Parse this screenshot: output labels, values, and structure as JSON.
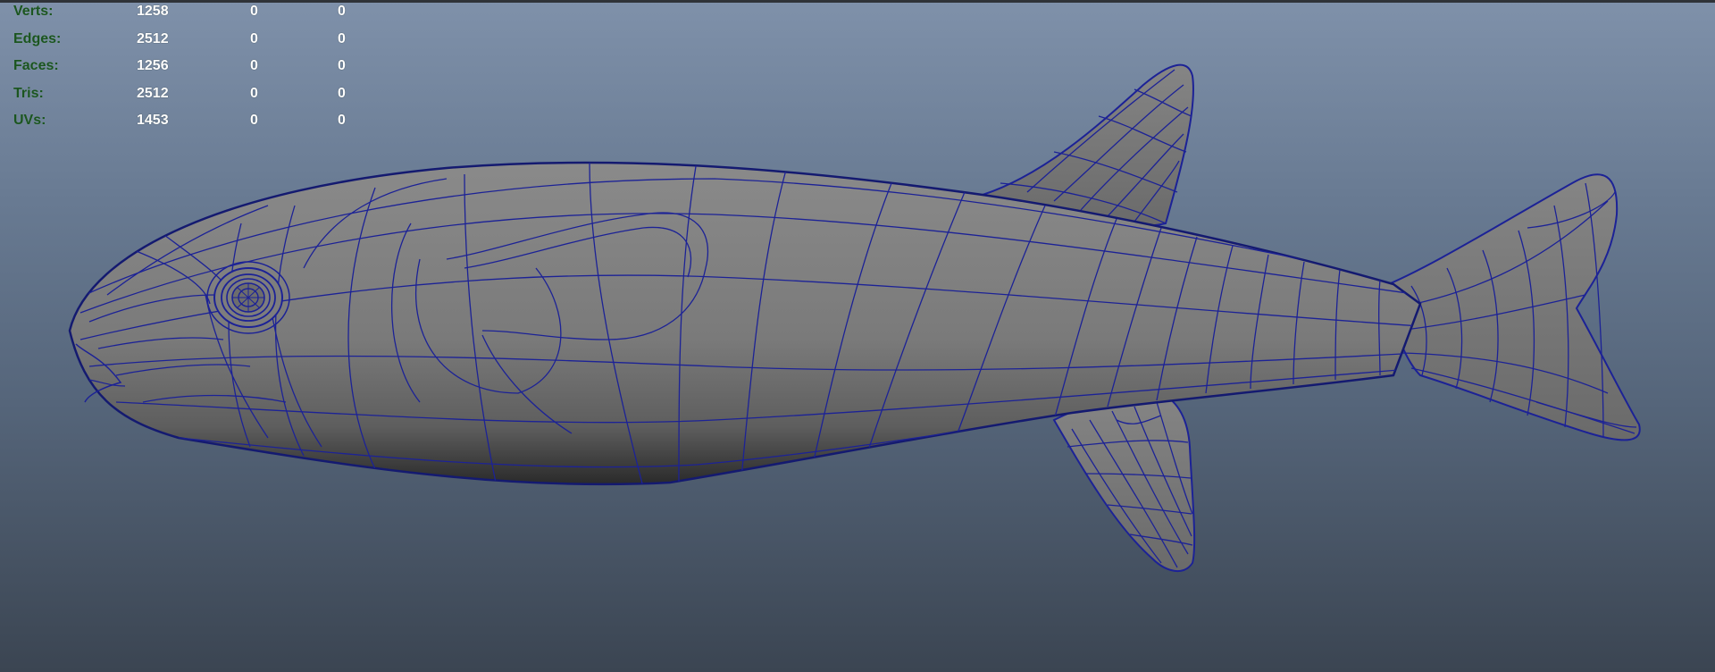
{
  "viewport": {
    "background_top": "#7f91aa",
    "background_bottom": "#3b4552",
    "wire_color": "#1c2296",
    "shade_color": "#7a7a7a"
  },
  "hud": {
    "rows": [
      {
        "label": "Verts:",
        "values": [
          "1258",
          "0",
          "0"
        ]
      },
      {
        "label": "Edges:",
        "values": [
          "2512",
          "0",
          "0"
        ]
      },
      {
        "label": "Faces:",
        "values": [
          "1256",
          "0",
          "0"
        ]
      },
      {
        "label": "Tris:",
        "values": [
          "2512",
          "0",
          "0"
        ]
      },
      {
        "label": "UVs:",
        "values": [
          "1453",
          "0",
          "0"
        ]
      }
    ]
  }
}
